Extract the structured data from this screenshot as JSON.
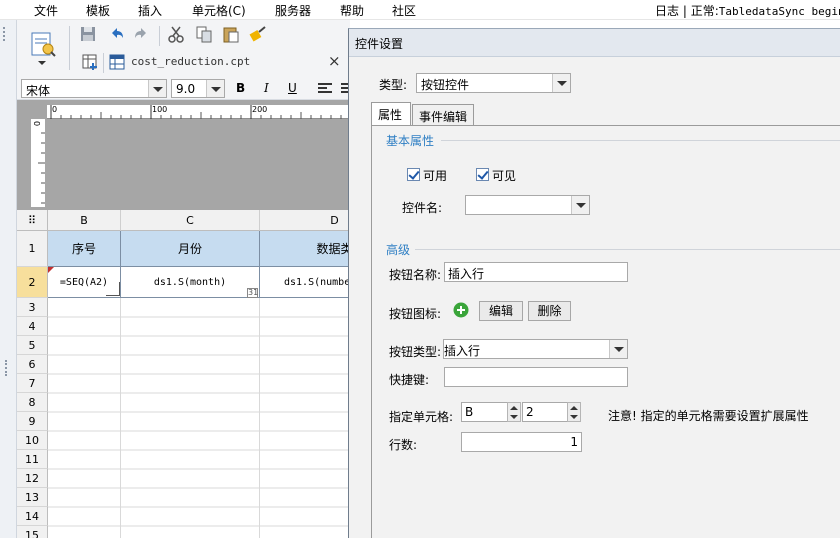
{
  "menu": [
    "文件",
    "模板",
    "插入",
    "单元格(C)",
    "服务器",
    "帮助",
    "社区"
  ],
  "status": {
    "log": "日志",
    "separator": "|",
    "prefix": "正常:",
    "text": "TabledataSync begin"
  },
  "file_tab": {
    "name": "cost_reduction.cpt",
    "close": "×"
  },
  "font": {
    "family": "宋体",
    "size": "9.0",
    "bold": "B",
    "italic": "I",
    "underline": "U"
  },
  "ruler": {
    "h_ticks": [
      "0",
      "100",
      "200"
    ],
    "v_ticks": [
      "0"
    ]
  },
  "grid": {
    "corner": "⠿",
    "columns": [
      "B",
      "C",
      "D"
    ],
    "rows": [
      "1",
      "2",
      "3",
      "4",
      "5",
      "6",
      "7",
      "8",
      "9",
      "10",
      "11",
      "12",
      "13",
      "14",
      "15"
    ],
    "header_row": [
      "序号",
      "月份",
      "数据类"
    ],
    "data_row": [
      "=SEQ(A2)",
      "ds1.S(month)",
      "ds1.S(numbe"
    ],
    "cell_marker": "31"
  },
  "dialog": {
    "title": "控件设置",
    "type_label": "类型:",
    "type_value": "按钮控件",
    "tabs": [
      "属性",
      "事件编辑"
    ],
    "basic_section": "基本属性",
    "enabled_label": "可用",
    "visible_label": "可见",
    "enabled_checked": true,
    "visible_checked": true,
    "widget_name_label": "控件名:",
    "widget_name_value": "",
    "advanced_section": "高级",
    "button_name_label": "按钮名称:",
    "button_name_value": "插入行",
    "button_icon_label": "按钮图标:",
    "edit_button": "编辑",
    "delete_button": "删除",
    "button_type_label": "按钮类型:",
    "button_type_value": "插入行",
    "shortcut_label": "快捷键:",
    "shortcut_value": "",
    "cell_label": "指定单元格:",
    "cell_col": "B",
    "cell_row": "2",
    "cell_note": "注意! 指定的单元格需要设置扩展属性",
    "rows_label": "行数:",
    "rows_value": "1"
  },
  "colors": {
    "accent": "#2f7fc4",
    "header_cell": "#c6dcf0",
    "add_icon": "#3aa53a"
  }
}
